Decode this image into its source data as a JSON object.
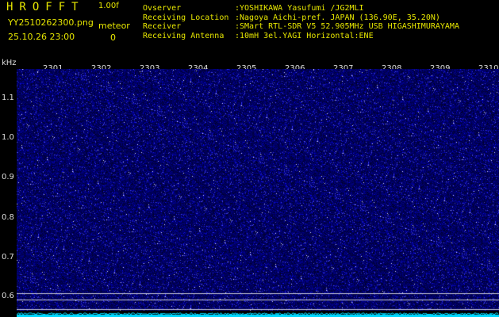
{
  "header": {
    "app_title": "HROFFT",
    "version": "1.00f",
    "filename": "YY2510262300.png",
    "datetime": "25.10.26 23:00",
    "meteor_label": "meteor",
    "meteor_count": "0",
    "info": [
      {
        "key": "Ovserver",
        "value": ":YOSHIKAWA Yasufumi /JG2MLI"
      },
      {
        "key": "Receiving Location",
        "value": ":Nagoya Aichi-pref. JAPAN (136.90E, 35.20N)"
      },
      {
        "key": "Receiver",
        "value": ":SMart RTL-SDR V5 52.905MHz USB HIGASHIMURAYAMA"
      },
      {
        "key": "Receiving Antenna",
        "value": ":10mH 3el.YAGI Horizontal:ENE"
      }
    ]
  },
  "axis": {
    "y_unit": "kHz",
    "y_ticks": [
      "1.1",
      "1.0",
      "0.9",
      "0.8",
      "0.7",
      "0.6"
    ],
    "x_ticks": [
      "2301",
      "2302",
      "2303",
      "2304",
      "2305",
      "2306",
      "2307",
      "2308",
      "2309",
      "2310"
    ]
  },
  "colors": {
    "background": "#000000",
    "header_text": "#e6e600",
    "waterfall_base": "#05055a",
    "noise": "#2a2aff",
    "baseline": "#00d8ff"
  }
}
